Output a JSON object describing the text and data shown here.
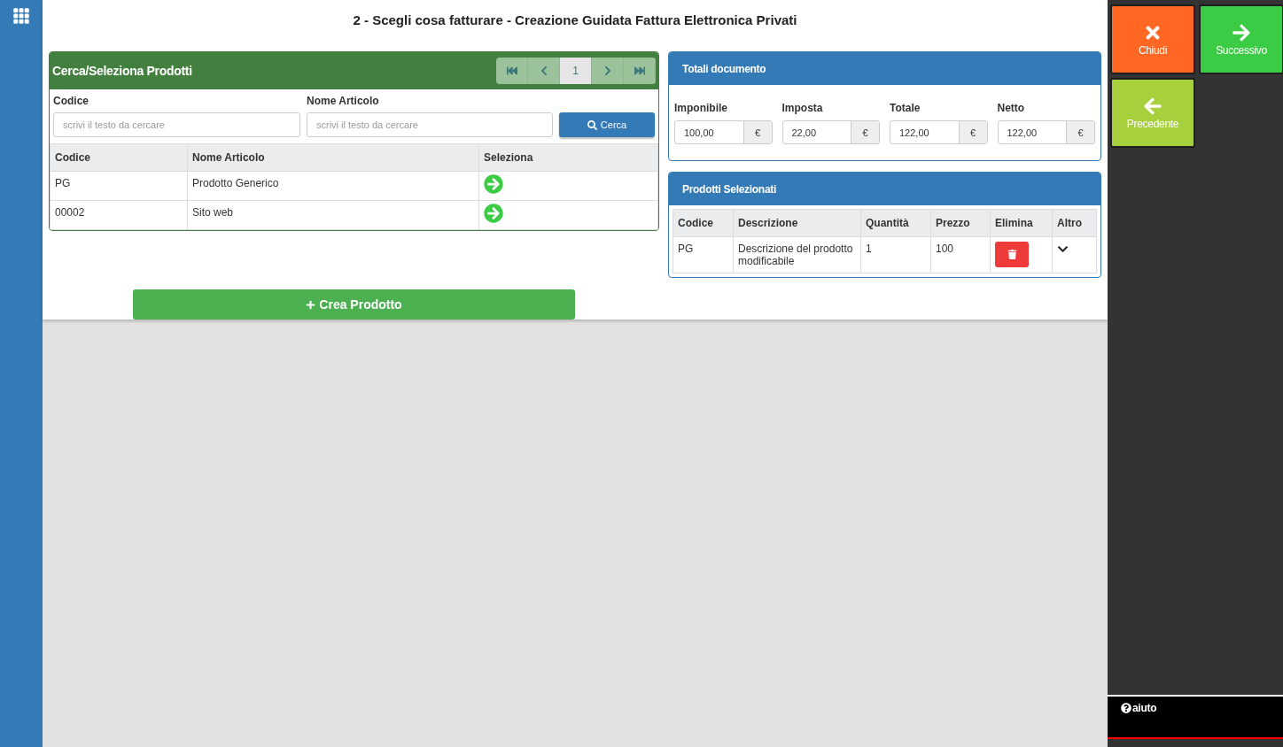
{
  "title": "2 - Scegli cosa fatturare - Creazione Guidata Fattura Elettronica Privati",
  "search_panel": {
    "title": "Cerca/Seleziona Prodotti",
    "pager": [
      {
        "kind": "first",
        "selected": false
      },
      {
        "kind": "prev",
        "selected": false
      },
      {
        "kind": "page",
        "label": "1",
        "selected": true
      },
      {
        "kind": "next",
        "selected": false
      },
      {
        "kind": "last",
        "selected": false
      }
    ],
    "fields": [
      {
        "label": "Codice",
        "placeholder": "scrivi il testo da cercare"
      },
      {
        "label": "Nome Articolo",
        "placeholder": "scrivi il testo da cercare"
      }
    ],
    "search_button": "Cerca",
    "columns": [
      "Codice",
      "Nome Articolo",
      "Seleziona"
    ],
    "rows": [
      {
        "code": "PG",
        "name": "Prodotto Generico"
      },
      {
        "code": "00002",
        "name": "Sito web"
      }
    ]
  },
  "create_button": "Crea Prodotto",
  "totals_panel": {
    "title": "Totali documento",
    "fields": [
      {
        "label": "Imponibile",
        "value": "100,00",
        "unit": "€"
      },
      {
        "label": "Imposta",
        "value": "22,00",
        "unit": "€"
      },
      {
        "label": "Totale",
        "value": "122,00",
        "unit": "€"
      },
      {
        "label": "Netto",
        "value": "122,00",
        "unit": "€"
      }
    ]
  },
  "selected_panel": {
    "title": "Prodotti Selezionati",
    "columns": [
      "Codice",
      "Descrizione",
      "Quantità",
      "Prezzo",
      "Elimina",
      "Altro"
    ],
    "rows": [
      {
        "code": "PG",
        "description": "Descrizione del prodotto modificabile",
        "quantity": "1",
        "price": "100"
      }
    ]
  },
  "tiles": [
    {
      "kind": "close",
      "label": "Chiudi",
      "color": "#ff6723"
    },
    {
      "kind": "next",
      "label": "Successivo",
      "color": "#3ccb45"
    },
    {
      "kind": "previous",
      "label": "Precedente",
      "color": "#a6d13c"
    }
  ],
  "help": "aiuto"
}
